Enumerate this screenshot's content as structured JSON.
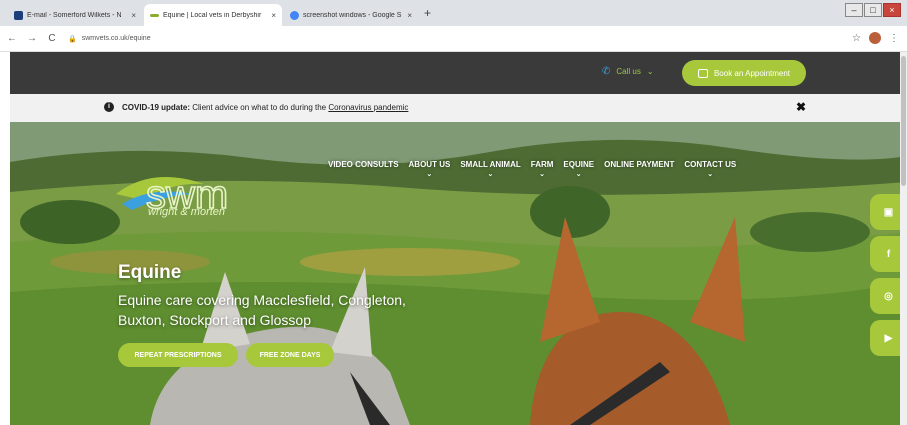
{
  "browser": {
    "tabs": [
      {
        "title": "E-mail - Somerford Wilkets - N",
        "close": "×",
        "favicon_color": "#1a3f7a"
      },
      {
        "title": "Equine | Local vets in Derbyshir",
        "close": "×",
        "favicon_color": "#8cae2f"
      },
      {
        "title": "screenshot windows - Google S",
        "close": "×",
        "favicon_color": "#4285f4"
      }
    ],
    "new_tab": "+",
    "window_controls": {
      "minimize": "–",
      "maximize": "□",
      "close": "×"
    },
    "address": "swmvets.co.uk/equine",
    "back": "←",
    "forward": "→",
    "reload": "C",
    "lock": "🔒",
    "star": "☆",
    "menu": "⋮"
  },
  "header": {
    "call_us": "Call us",
    "call_chevron": "⌄",
    "book_button": "Book an Appointment"
  },
  "covid": {
    "label": "COVID-19 update:",
    "message": "Client advice on what to do during the",
    "link": "Coronavirus pandemic",
    "close": "✖"
  },
  "logo": {
    "text": "swm",
    "sub": "wright & morten"
  },
  "nav": {
    "items": [
      {
        "label": "VIDEO CONSULTS",
        "chevron": ""
      },
      {
        "label": "ABOUT US",
        "chevron": "⌄"
      },
      {
        "label": "SMALL ANIMAL",
        "chevron": "⌄"
      },
      {
        "label": "FARM",
        "chevron": "⌄"
      },
      {
        "label": "EQUINE",
        "chevron": "⌄"
      },
      {
        "label": "ONLINE PAYMENT",
        "chevron": ""
      },
      {
        "label": "CONTACT US",
        "chevron": "⌄"
      }
    ]
  },
  "hero": {
    "title": "Equine",
    "text": "Equine care covering Macclesfield, Congleton, Buxton, Stockport and Glossop",
    "buttons": [
      "REPEAT PRESCRIPTIONS",
      "FREE ZONE DAYS"
    ]
  },
  "social": {
    "items": [
      {
        "icon": "calendar-icon",
        "glyph": "▣"
      },
      {
        "icon": "facebook-icon",
        "glyph": "f"
      },
      {
        "icon": "instagram-icon",
        "glyph": "◎"
      },
      {
        "icon": "youtube-icon",
        "glyph": "▶"
      }
    ]
  },
  "colors": {
    "brand_green": "#a7c83a",
    "header_dark": "#3a3a3a",
    "phone_blue": "#3aa0e0"
  }
}
